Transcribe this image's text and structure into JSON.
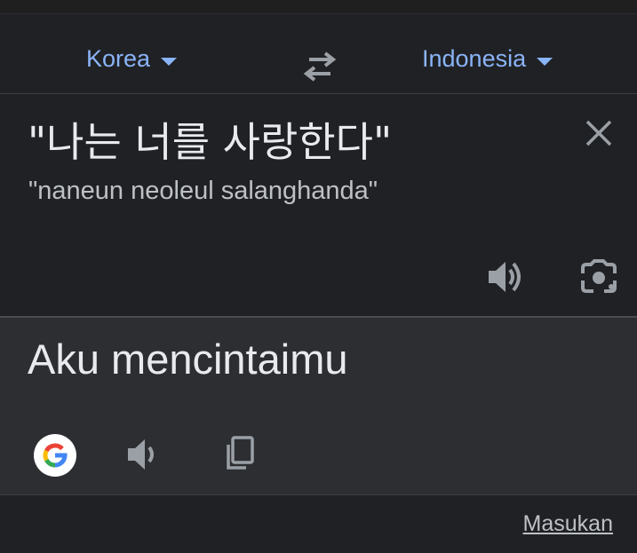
{
  "language_bar": {
    "source_language": "Korea",
    "target_language": "Indonesia",
    "swap_icon": "swap-arrows-icon"
  },
  "source": {
    "text": "\"나는 너를 사랑한다\"",
    "transliteration": "\"naneun neoleul salanghanda\"",
    "clear_icon": "close-icon",
    "speak_icon": "volume-icon",
    "camera_icon": "lens-camera-icon"
  },
  "result": {
    "text": "Aku mencintaimu",
    "google_icon": "google-g-icon",
    "speak_icon": "volume-icon",
    "copy_icon": "copy-icon"
  },
  "footer": {
    "feedback_label": "Masukan"
  },
  "colors": {
    "background": "#202124",
    "result_background": "#2d2e31",
    "accent": "#8ab4f8",
    "text_primary": "#e8eaed",
    "text_secondary": "#bdc1c6",
    "icon": "#9aa0a6"
  }
}
